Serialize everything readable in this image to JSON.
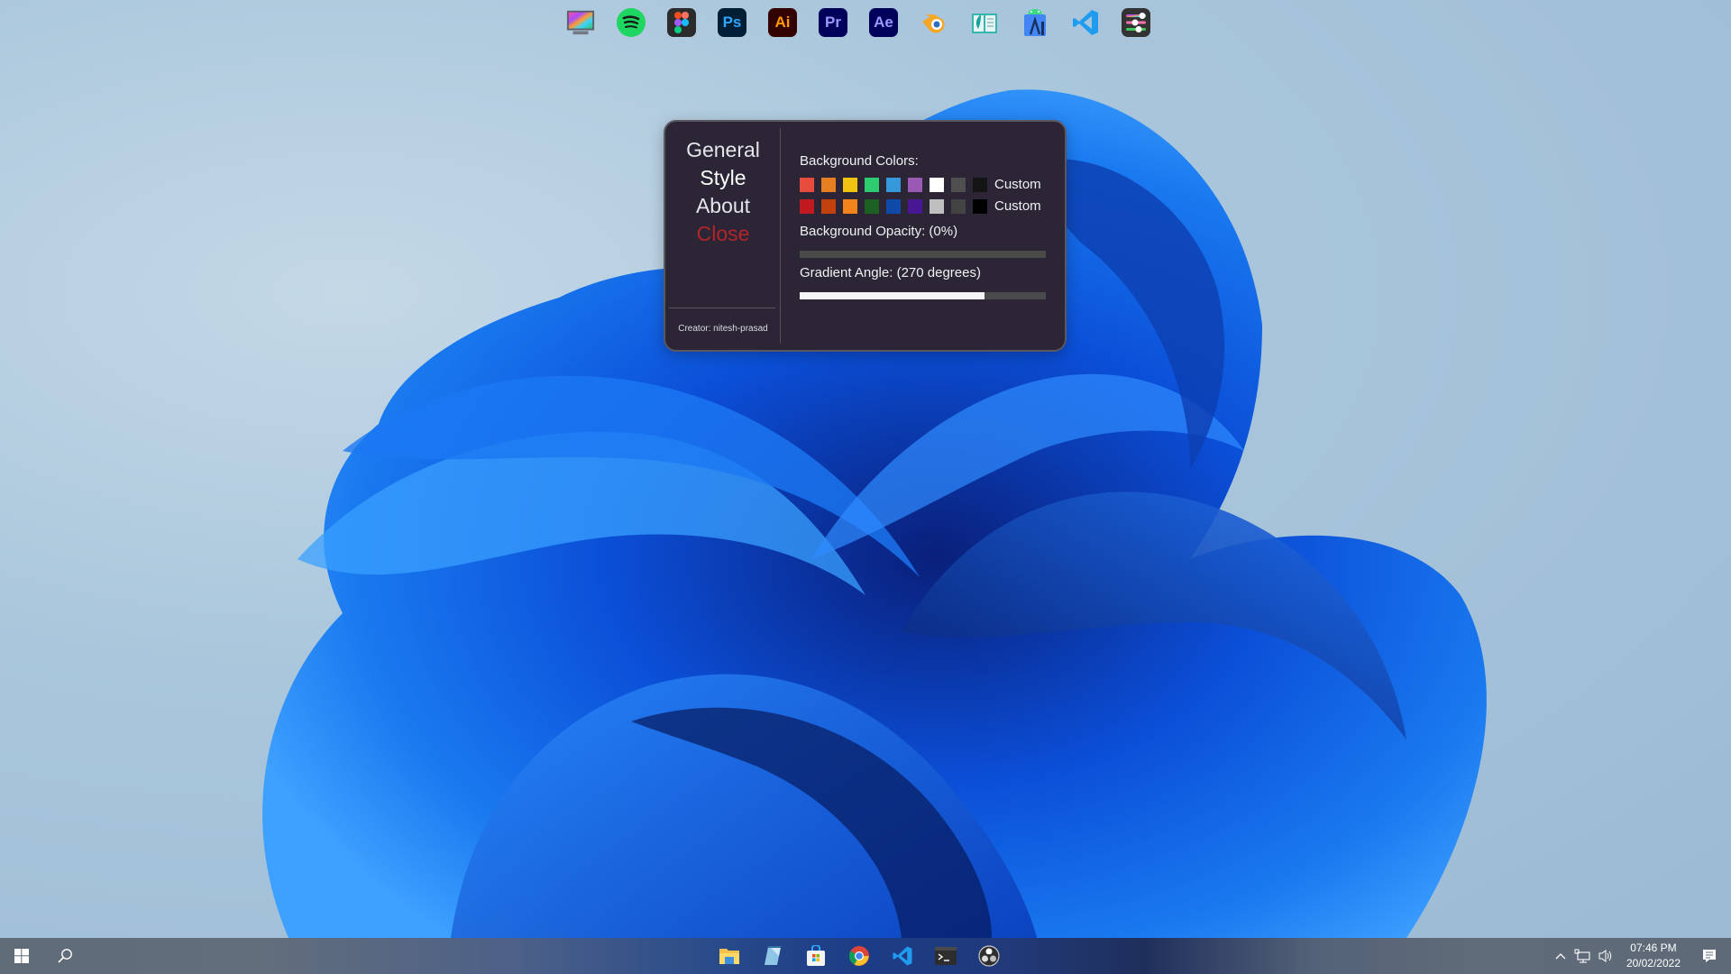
{
  "dock": {
    "apps": [
      {
        "name": "Rainmeter Display",
        "icon": "display-rainbow-icon"
      },
      {
        "name": "Spotify",
        "icon": "spotify-icon",
        "color": "#1ed760"
      },
      {
        "name": "Figma",
        "icon": "figma-icon"
      },
      {
        "name": "Photoshop",
        "icon": "photoshop-icon",
        "label": "Ps",
        "bg": "#001e36",
        "fg": "#31a8ff"
      },
      {
        "name": "Illustrator",
        "icon": "illustrator-icon",
        "label": "Ai",
        "bg": "#330000",
        "fg": "#ff9a00"
      },
      {
        "name": "Premiere Pro",
        "icon": "premiere-icon",
        "label": "Pr",
        "bg": "#00005b",
        "fg": "#9999ff"
      },
      {
        "name": "After Effects",
        "icon": "after-effects-icon",
        "label": "Ae",
        "bg": "#00005b",
        "fg": "#9999ff"
      },
      {
        "name": "Blender",
        "icon": "blender-icon"
      },
      {
        "name": "Notebook",
        "icon": "book-icon"
      },
      {
        "name": "Android Studio",
        "icon": "android-studio-icon"
      },
      {
        "name": "VS Code",
        "icon": "vscode-icon"
      },
      {
        "name": "Settings Sliders",
        "icon": "sliders-icon"
      }
    ]
  },
  "panel": {
    "nav": {
      "general": "General",
      "style": "Style",
      "about": "About",
      "close": "Close",
      "active": "Style"
    },
    "creator": "Creator: nitesh-prasad",
    "background_colors_label": "Background Colors:",
    "swatch_rows": [
      {
        "colors": [
          "#e74c3c",
          "#e67e22",
          "#f1c40f",
          "#2ecc71",
          "#3498db",
          "#9b59b6",
          "#ffffff",
          "#4f4f4f",
          "#141414"
        ],
        "custom_label": "Custom"
      },
      {
        "colors": [
          "#c0191f",
          "#c2410c",
          "#f3841b",
          "#1c6022",
          "#0f4aa8",
          "#4a1794",
          "#bfbfbf",
          "#434343",
          "#000000"
        ],
        "custom_label": "Custom"
      }
    ],
    "opacity_label": "Background Opacity: (0%)",
    "opacity_value": 0,
    "gradient_label": "Gradient Angle: (270 degrees)",
    "gradient_fraction": 0.75
  },
  "taskbar": {
    "start": "windows-start-icon",
    "search": "search-icon",
    "apps": [
      "File Explorer",
      "Notepad",
      "Microsoft Store",
      "Google Chrome",
      "Visual Studio Code",
      "Terminal",
      "OBS Studio"
    ],
    "clock": {
      "time": "07:46 PM",
      "date": "20/02/2022"
    }
  }
}
